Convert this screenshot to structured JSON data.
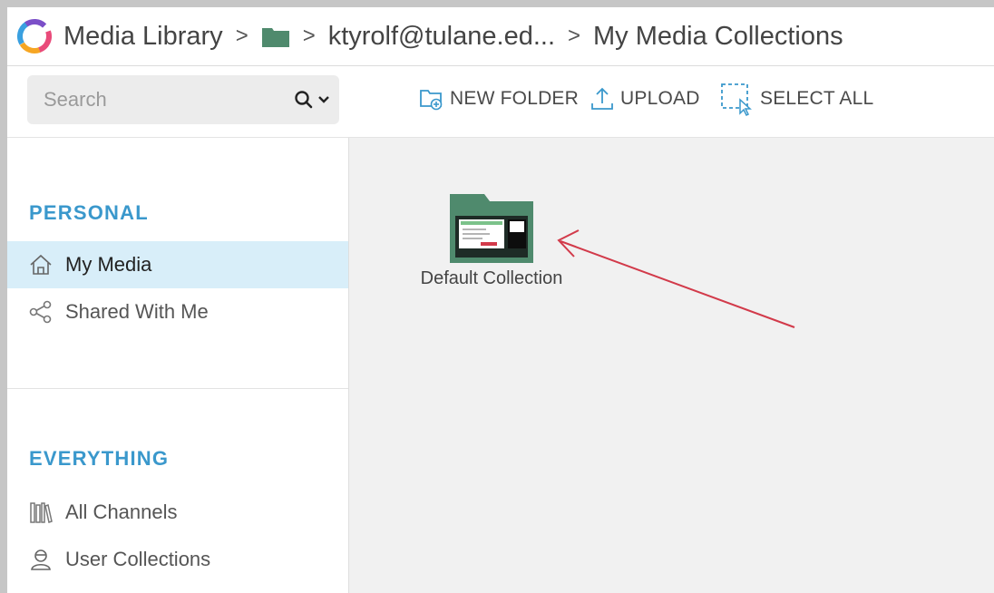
{
  "header": {
    "app_title": "Media Library",
    "breadcrumb_user": "ktyrolf@tulane.ed...",
    "breadcrumb_current": "My Media Collections",
    "separator": ">"
  },
  "toolbar": {
    "search_placeholder": "Search",
    "new_folder": "NEW FOLDER",
    "upload": "UPLOAD",
    "select_all": "SELECT ALL"
  },
  "sidebar": {
    "personal_title": "PERSONAL",
    "personal_items": [
      {
        "label": "My Media",
        "icon": "home-icon",
        "active": true
      },
      {
        "label": "Shared With Me",
        "icon": "share-icon",
        "active": false
      }
    ],
    "everything_title": "EVERYTHING",
    "everything_items": [
      {
        "label": "All Channels",
        "icon": "channels-icon"
      },
      {
        "label": "User Collections",
        "icon": "user-icon"
      }
    ]
  },
  "main": {
    "collections": [
      {
        "label": "Default Collection",
        "icon": "collection-folder-icon"
      }
    ]
  },
  "colors": {
    "accent": "#3a98cc",
    "active_bg": "#d8eef9",
    "folder": "#4f8a6d",
    "arrow": "#d23a4a"
  }
}
